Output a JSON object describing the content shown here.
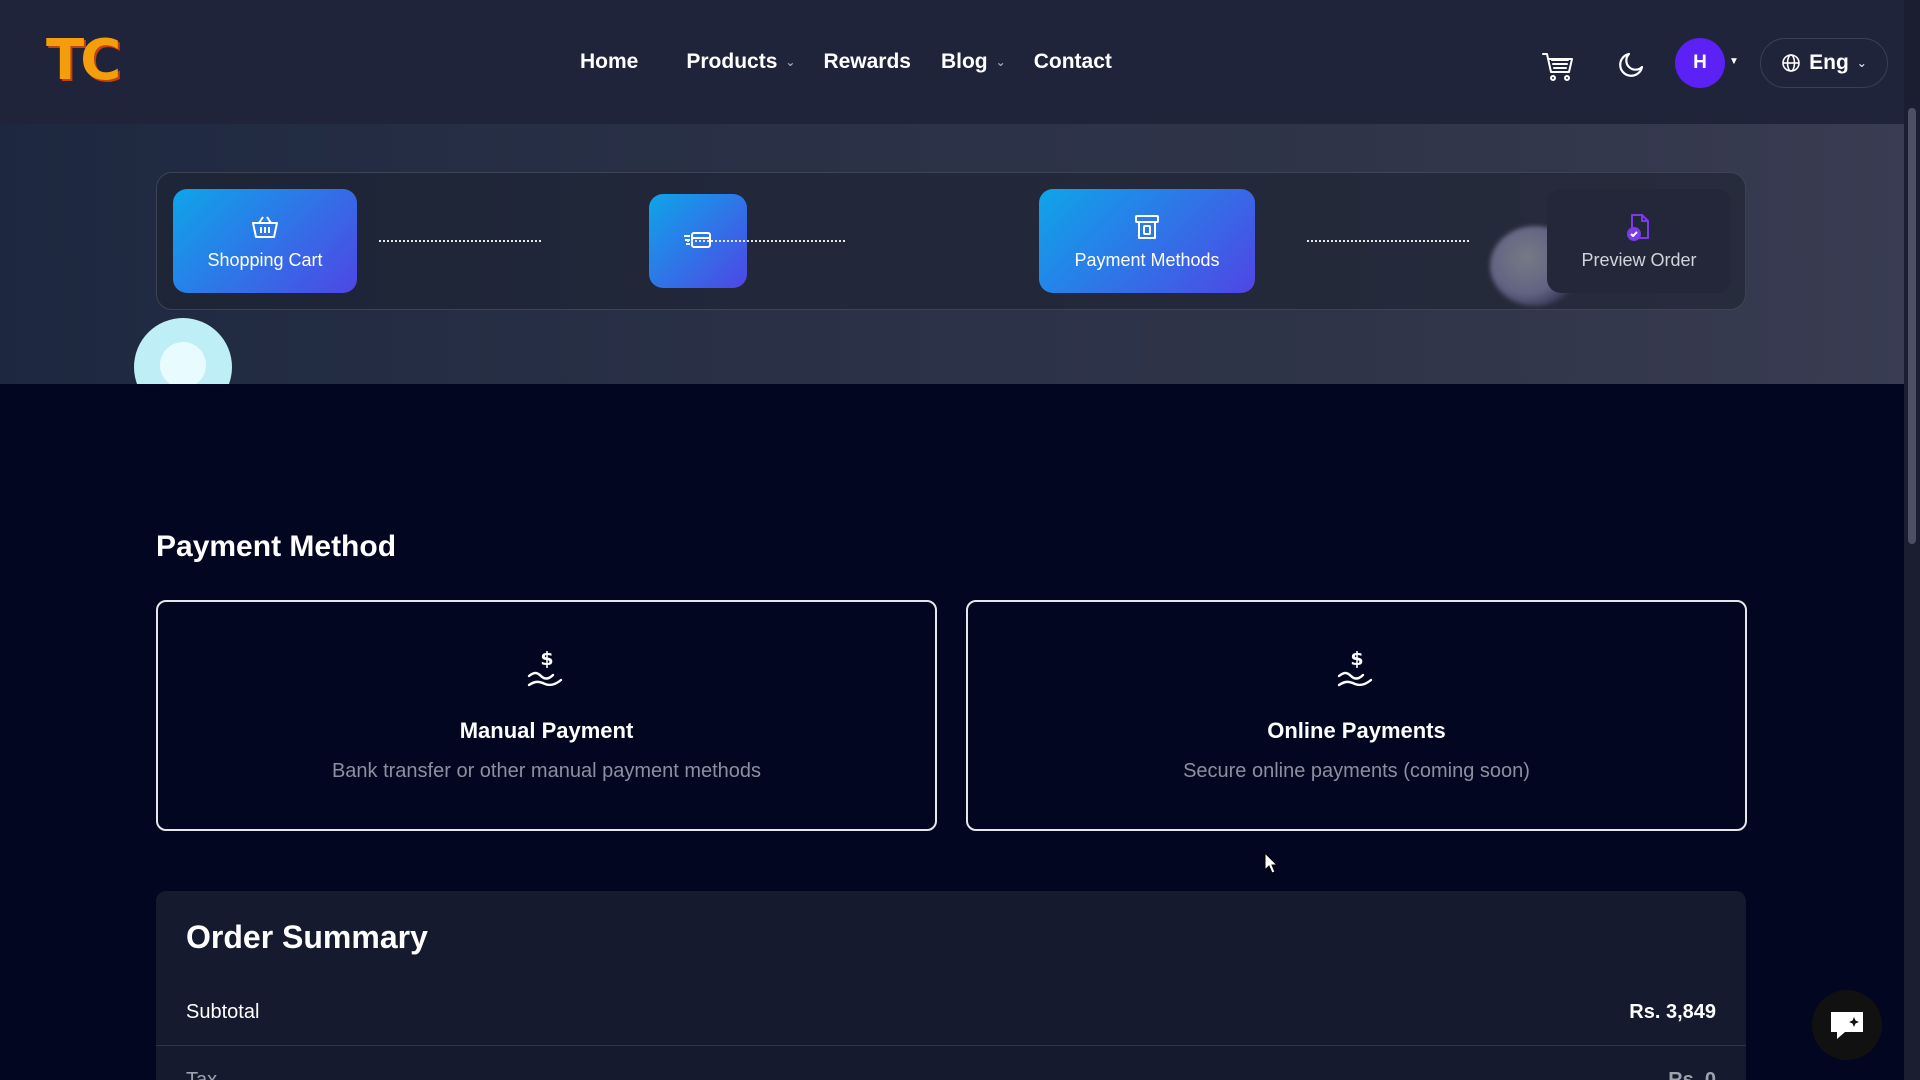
{
  "header": {
    "logo_text": "TC",
    "nav": [
      {
        "label": "Home",
        "has_dropdown": false
      },
      {
        "label": "Products",
        "has_dropdown": true
      },
      {
        "label": "Rewards",
        "has_dropdown": false
      },
      {
        "label": "Blog",
        "has_dropdown": true
      },
      {
        "label": "Contact",
        "has_dropdown": false
      }
    ],
    "avatar_initial": "H",
    "language": "Eng"
  },
  "stepper": {
    "steps": [
      {
        "label": "Shopping Cart",
        "icon": "basket-icon",
        "state": "completed"
      },
      {
        "label": "",
        "icon": "shipping-icon",
        "state": "completed"
      },
      {
        "label": "Payment Methods",
        "icon": "payment-icon",
        "state": "active"
      },
      {
        "label": "Preview Order",
        "icon": "document-check-icon",
        "state": "pending"
      }
    ]
  },
  "payment": {
    "title": "Payment Method",
    "options": [
      {
        "title": "Manual Payment",
        "description": "Bank transfer or other manual payment methods",
        "icon": "dollar-hand-icon"
      },
      {
        "title": "Online Payments",
        "description": "Secure online payments (coming soon)",
        "icon": "dollar-hand-icon"
      }
    ]
  },
  "summary": {
    "title": "Order Summary",
    "rows": [
      {
        "label": "Subtotal",
        "value": "Rs. 3,849"
      },
      {
        "label": "Tax",
        "value": "Rs. 0"
      }
    ]
  },
  "colors": {
    "background": "#020620",
    "header": "#20243a",
    "accent_gradient_start": "#0ea5e9",
    "accent_gradient_end": "#4f46e5",
    "avatar": "#5b21f5",
    "logo": "#f59e0b"
  }
}
